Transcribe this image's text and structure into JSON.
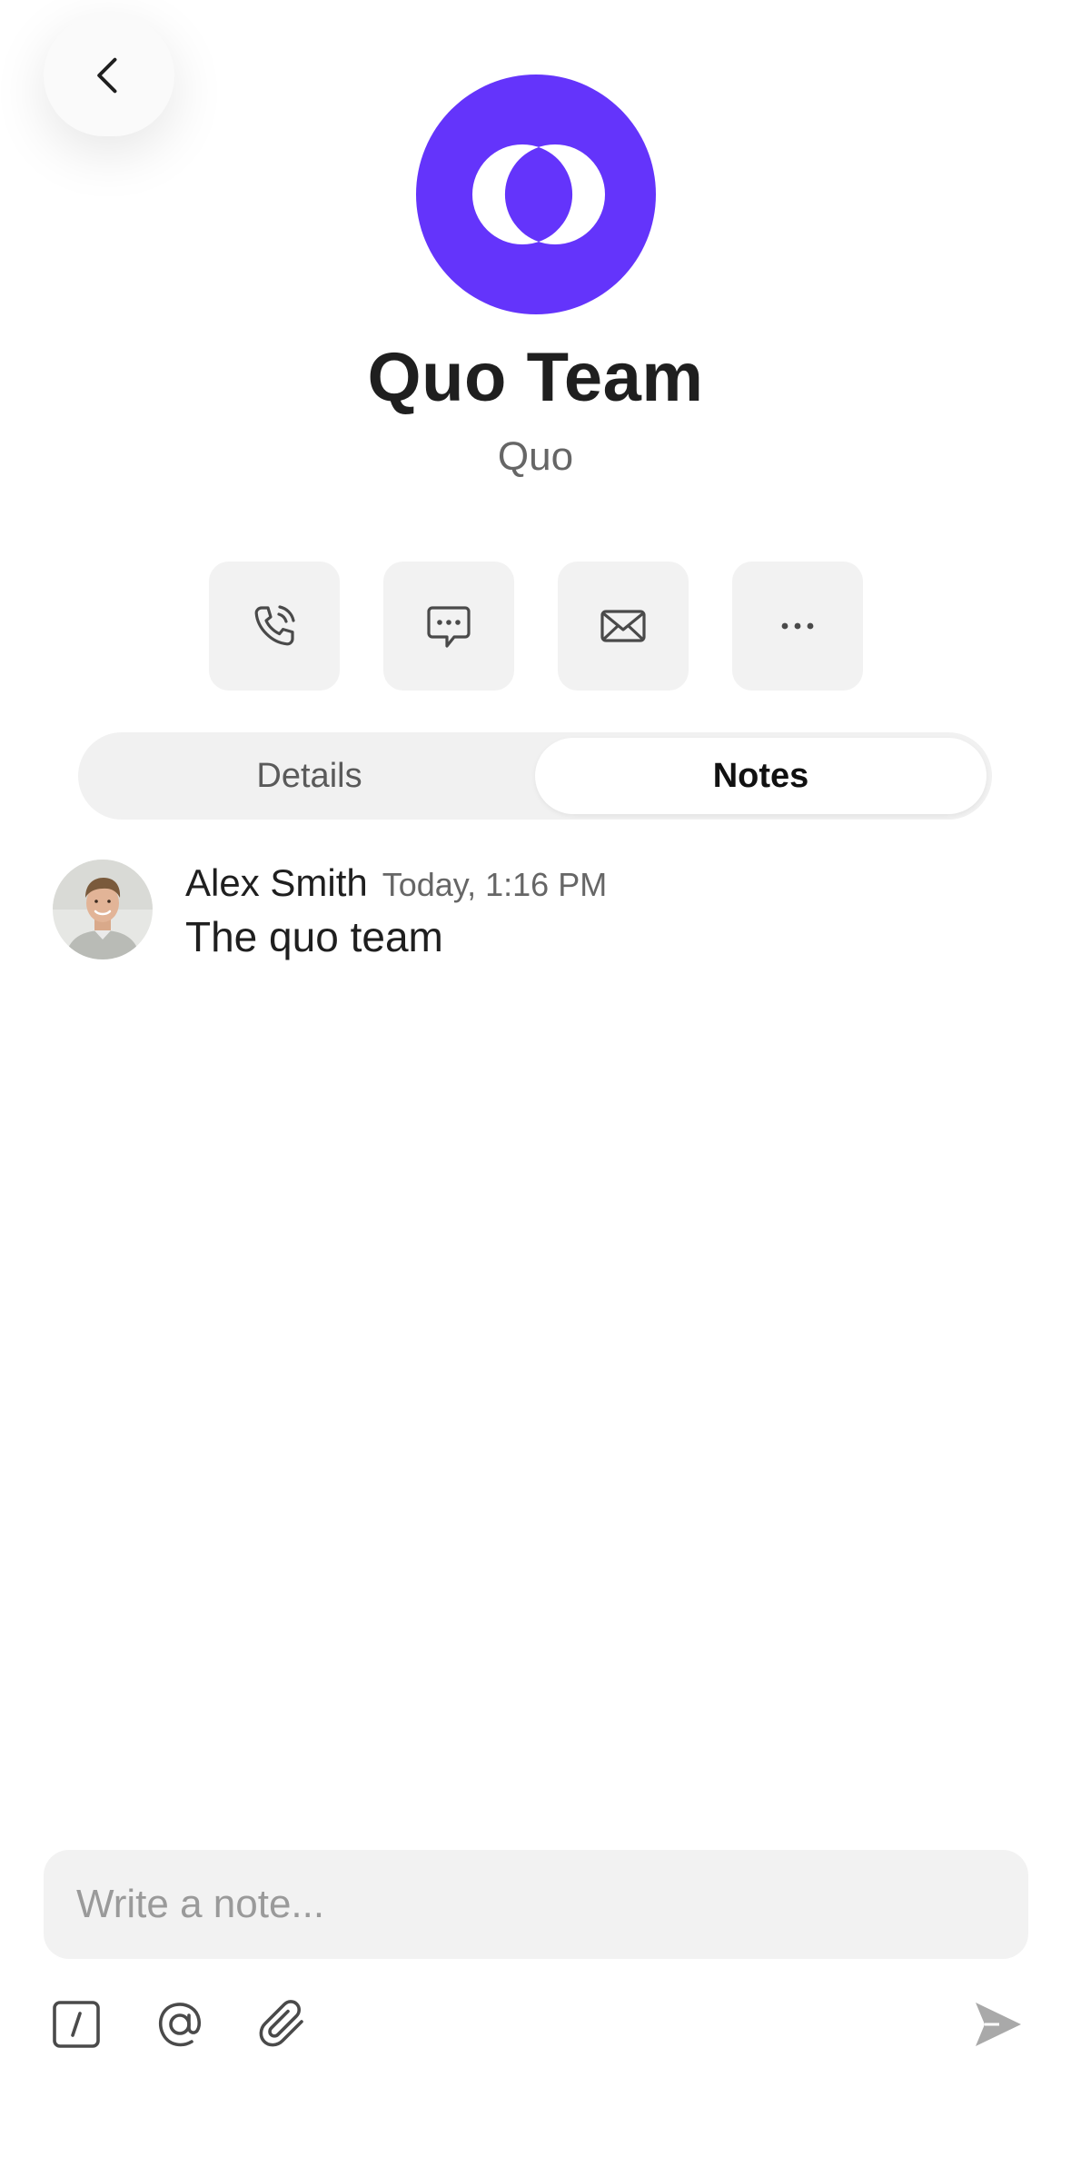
{
  "contact": {
    "name": "Quo Team",
    "company": "Quo",
    "avatar_color": "#6434fb"
  },
  "actions": [
    {
      "icon": "phone-icon"
    },
    {
      "icon": "message-icon"
    },
    {
      "icon": "mail-icon"
    },
    {
      "icon": "more-icon"
    }
  ],
  "tabs": {
    "details_label": "Details",
    "notes_label": "Notes",
    "active": "Notes"
  },
  "notes": [
    {
      "author": "Alex Smith",
      "time": "Today, 1:16 PM",
      "text": "The quo team"
    }
  ],
  "composer": {
    "placeholder": "Write a note..."
  },
  "toolbar": {
    "icons": [
      "slash-command-icon",
      "mention-icon",
      "attachment-icon",
      "send-icon"
    ]
  }
}
